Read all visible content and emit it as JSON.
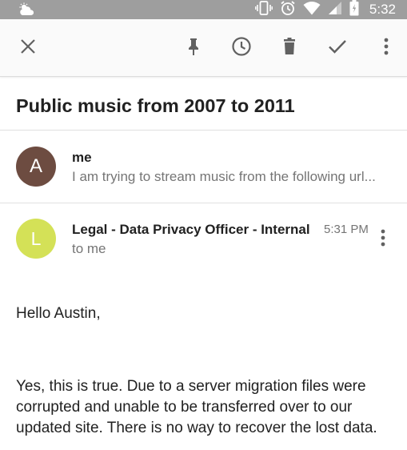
{
  "status_bar": {
    "time": "5:32",
    "icons": [
      "weather-icon",
      "vibrate-icon",
      "alarm-icon",
      "wifi-icon",
      "signal-icon",
      "battery-icon"
    ]
  },
  "toolbar": {
    "icons": [
      "close-icon",
      "pin-icon",
      "snooze-icon",
      "delete-icon",
      "done-icon",
      "more-vert-icon"
    ]
  },
  "thread": {
    "subject": "Public music from 2007 to 2011"
  },
  "messages": [
    {
      "avatar_letter": "A",
      "avatar_color": "#6d4c41",
      "sender": "me",
      "snippet": "I am trying to stream music from the following url..."
    },
    {
      "avatar_letter": "L",
      "avatar_color": "#d4e157",
      "sender": "Legal - Data Privacy Officer - Internal",
      "recipient": "to me",
      "time": "5:31 PM",
      "greeting": "Hello Austin,",
      "body": "Yes, this is true.  Due to a server migration files were corrupted and unable to be transferred over to our updated site.  There is no way to recover the lost data."
    }
  ]
}
